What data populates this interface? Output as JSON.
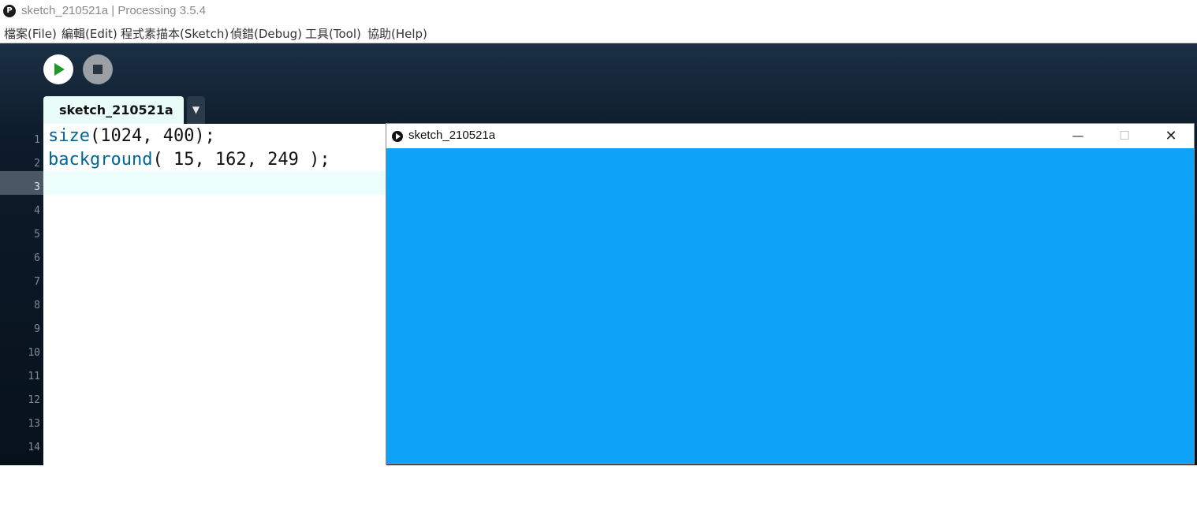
{
  "window": {
    "title": "sketch_210521a | Processing 3.5.4",
    "app_icon": "processing-logo-icon",
    "app_icon_glyph": "P"
  },
  "menubar": {
    "items": [
      {
        "label": "檔案(File)"
      },
      {
        "label": "編輯(Edit)"
      },
      {
        "label": "程式素描本(Sketch)"
      },
      {
        "label": "偵錯(Debug)"
      },
      {
        "label": "工具(Tool)"
      },
      {
        "label": "協助(Help)"
      }
    ]
  },
  "toolbar": {
    "run_icon": "play-icon",
    "stop_icon": "stop-icon"
  },
  "tabs": [
    {
      "label": "sketch_210521a",
      "active": true
    }
  ],
  "tab_menu_glyph": "▼",
  "editor": {
    "lines": [
      {
        "fn": "size",
        "args": "(1024, 400);"
      },
      {
        "fn": "background",
        "args": "( 15, 162, 249 );"
      },
      {
        "fn": "",
        "args": ""
      }
    ],
    "line_numbers": [
      "1",
      "2",
      "3",
      "4",
      "5",
      "6",
      "7",
      "8",
      "9",
      "10",
      "11",
      "12",
      "13",
      "14"
    ],
    "current_line": "3"
  },
  "sketch_window": {
    "title": "sketch_210521a",
    "minimize_glyph": "—",
    "maximize_glyph": "☐",
    "close_glyph": "✕",
    "canvas_color": "#0fa2f9"
  },
  "colors": {
    "keyword": "#006699",
    "run_green": "#1f9a2a",
    "current_line": "#ecfffc"
  }
}
